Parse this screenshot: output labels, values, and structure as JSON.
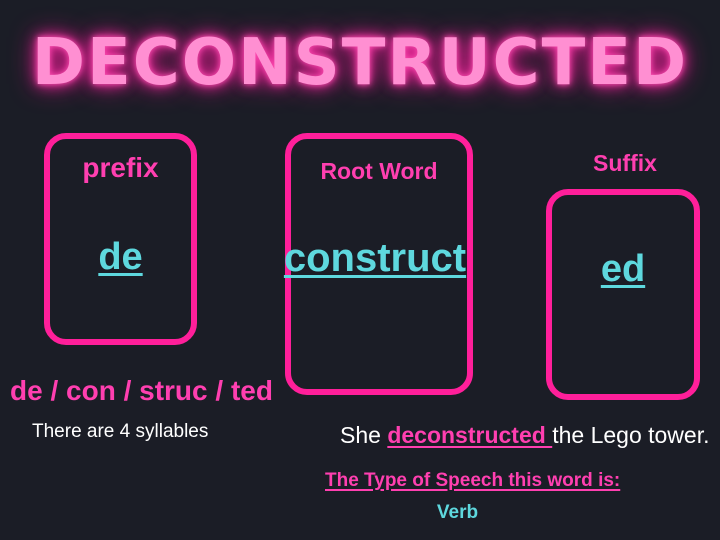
{
  "title": "DECONSTRUCTED",
  "prefix": {
    "label": "prefix",
    "value": "de"
  },
  "root": {
    "label": "Root Word",
    "value": "construct"
  },
  "suffix": {
    "label": "Suffix",
    "value": "ed"
  },
  "syllables": {
    "breakdown": "de / con / struc / ted",
    "count_text": "There are 4 syllables"
  },
  "sentence": {
    "before": "She ",
    "highlight": "deconstructed ",
    "after": "the Lego tower."
  },
  "part_of_speech": {
    "question": "The Type of Speech this word is:",
    "answer": "Verb"
  },
  "colors": {
    "background": "#1b1d26",
    "accent_pink": "#ff1f9a",
    "label_pink": "#ff3fb0",
    "teal": "#5ed8de",
    "white": "#ffffff"
  }
}
